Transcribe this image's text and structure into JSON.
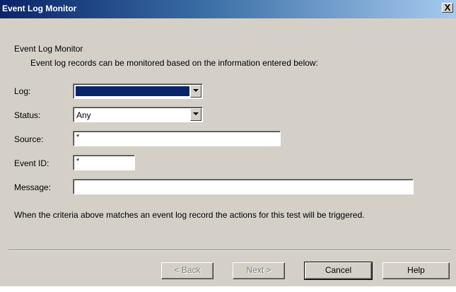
{
  "window": {
    "title": "Event Log Monitor",
    "close_glyph": "X"
  },
  "header": {
    "heading": "Event Log Monitor",
    "description": "Event log records can be monitored based on the information entered below:"
  },
  "form": {
    "log": {
      "label": "Log:",
      "value": ""
    },
    "status": {
      "label": "Status:",
      "value": "Any"
    },
    "source": {
      "label": "Source:",
      "value": "*"
    },
    "event_id": {
      "label": "Event ID:",
      "value": "*"
    },
    "message": {
      "label": "Message:",
      "value": ""
    }
  },
  "note": "When the criteria above matches an event log record the actions for this test will be triggered.",
  "buttons": {
    "back": "< Back",
    "next": "Next >",
    "cancel": "Cancel",
    "help": "Help"
  },
  "colors": {
    "title_bar": "#0a246a",
    "dialog_face": "#d4d0c8",
    "selection": "#0a246a"
  }
}
